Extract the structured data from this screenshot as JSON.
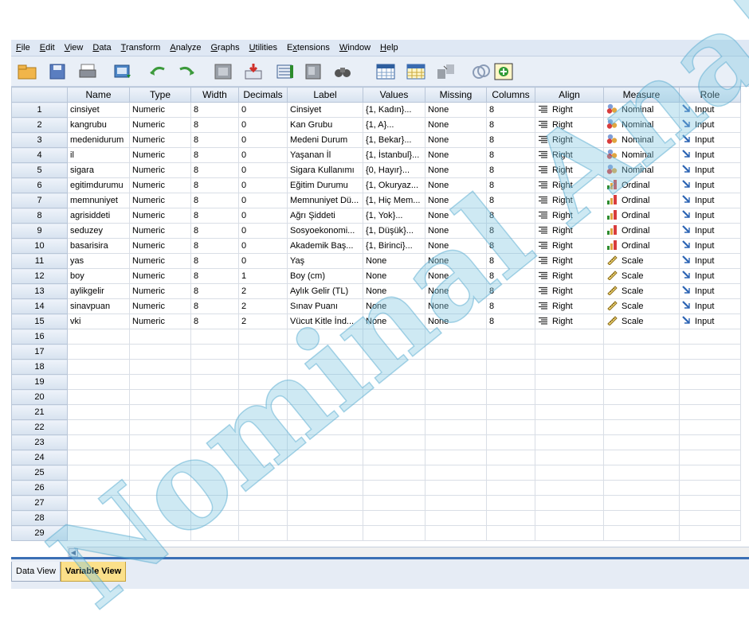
{
  "menu": [
    "File",
    "Edit",
    "View",
    "Data",
    "Transform",
    "Analyze",
    "Graphs",
    "Utilities",
    "Extensions",
    "Window",
    "Help"
  ],
  "menu_underline": [
    "F",
    "E",
    "V",
    "D",
    "T",
    "A",
    "G",
    "U",
    "x",
    "W",
    "H"
  ],
  "toolbar_icons": [
    "open-folder-icon",
    "save-icon",
    "print-icon",
    "dialog-recall-icon",
    "undo-icon",
    "redo-icon",
    "goto-case-icon",
    "goto-variable-icon",
    "variables-icon",
    "run-descriptives-icon",
    "find-icon",
    "split-file-icon",
    "select-cases-icon",
    "value-labels-icon",
    "use-sets-icon",
    "show-all-variables-icon"
  ],
  "columns": [
    "Name",
    "Type",
    "Width",
    "Decimals",
    "Label",
    "Values",
    "Missing",
    "Columns",
    "Align",
    "Measure",
    "Role"
  ],
  "rows": [
    {
      "n": "1",
      "name": "cinsiyet",
      "type": "Numeric",
      "width": "8",
      "dec": "0",
      "label": "Cinsiyet",
      "values": "{1, Kadın}...",
      "missing": "None",
      "columns": "8",
      "align": "Right",
      "measure": "Nominal",
      "role": "Input"
    },
    {
      "n": "2",
      "name": "kangrubu",
      "type": "Numeric",
      "width": "8",
      "dec": "0",
      "label": "Kan Grubu",
      "values": "{1, A}...",
      "missing": "None",
      "columns": "8",
      "align": "Right",
      "measure": "Nominal",
      "role": "Input"
    },
    {
      "n": "3",
      "name": "medenidurum",
      "type": "Numeric",
      "width": "8",
      "dec": "0",
      "label": "Medeni Durum",
      "values": "{1, Bekar}...",
      "missing": "None",
      "columns": "8",
      "align": "Right",
      "measure": "Nominal",
      "role": "Input"
    },
    {
      "n": "4",
      "name": "il",
      "type": "Numeric",
      "width": "8",
      "dec": "0",
      "label": "Yaşanan İl",
      "values": "{1, İstanbul}...",
      "missing": "None",
      "columns": "8",
      "align": "Right",
      "measure": "Nominal",
      "role": "Input"
    },
    {
      "n": "5",
      "name": "sigara",
      "type": "Numeric",
      "width": "8",
      "dec": "0",
      "label": "Sigara Kullanımı",
      "values": "{0, Hayır}...",
      "missing": "None",
      "columns": "8",
      "align": "Right",
      "measure": "Nominal",
      "role": "Input"
    },
    {
      "n": "6",
      "name": "egitimdurumu",
      "type": "Numeric",
      "width": "8",
      "dec": "0",
      "label": "Eğitim Durumu",
      "values": "{1, Okuryaz...",
      "missing": "None",
      "columns": "8",
      "align": "Right",
      "measure": "Ordinal",
      "role": "Input"
    },
    {
      "n": "7",
      "name": "memnuniyet",
      "type": "Numeric",
      "width": "8",
      "dec": "0",
      "label": "Memnuniyet Dü...",
      "values": "{1, Hiç Mem...",
      "missing": "None",
      "columns": "8",
      "align": "Right",
      "measure": "Ordinal",
      "role": "Input"
    },
    {
      "n": "8",
      "name": "agrisiddeti",
      "type": "Numeric",
      "width": "8",
      "dec": "0",
      "label": "Ağrı Şiddeti",
      "values": "{1, Yok}...",
      "missing": "None",
      "columns": "8",
      "align": "Right",
      "measure": "Ordinal",
      "role": "Input"
    },
    {
      "n": "9",
      "name": "seduzey",
      "type": "Numeric",
      "width": "8",
      "dec": "0",
      "label": "Sosyoekonomi...",
      "values": "{1, Düşük}...",
      "missing": "None",
      "columns": "8",
      "align": "Right",
      "measure": "Ordinal",
      "role": "Input"
    },
    {
      "n": "10",
      "name": "basarisira",
      "type": "Numeric",
      "width": "8",
      "dec": "0",
      "label": "Akademik Baş...",
      "values": "{1, Birinci}...",
      "missing": "None",
      "columns": "8",
      "align": "Right",
      "measure": "Ordinal",
      "role": "Input"
    },
    {
      "n": "11",
      "name": "yas",
      "type": "Numeric",
      "width": "8",
      "dec": "0",
      "label": "Yaş",
      "values": "None",
      "missing": "None",
      "columns": "8",
      "align": "Right",
      "measure": "Scale",
      "role": "Input"
    },
    {
      "n": "12",
      "name": "boy",
      "type": "Numeric",
      "width": "8",
      "dec": "1",
      "label": "Boy (cm)",
      "values": "None",
      "missing": "None",
      "columns": "8",
      "align": "Right",
      "measure": "Scale",
      "role": "Input"
    },
    {
      "n": "13",
      "name": "aylikgelir",
      "type": "Numeric",
      "width": "8",
      "dec": "2",
      "label": "Aylık Gelir (TL)",
      "values": "None",
      "missing": "None",
      "columns": "8",
      "align": "Right",
      "measure": "Scale",
      "role": "Input"
    },
    {
      "n": "14",
      "name": "sinavpuan",
      "type": "Numeric",
      "width": "8",
      "dec": "2",
      "label": "Sınav Puanı",
      "values": "None",
      "missing": "None",
      "columns": "8",
      "align": "Right",
      "measure": "Scale",
      "role": "Input"
    },
    {
      "n": "15",
      "name": "vki",
      "type": "Numeric",
      "width": "8",
      "dec": "2",
      "label": "Vücut Kitle İnd...",
      "values": "None",
      "missing": "None",
      "columns": "8",
      "align": "Right",
      "measure": "Scale",
      "role": "Input"
    }
  ],
  "empty_rows": [
    "16",
    "17",
    "18",
    "19",
    "20",
    "21",
    "22",
    "23",
    "24",
    "25",
    "26",
    "27",
    "28",
    "29"
  ],
  "tabs": {
    "data_view": "Data View",
    "variable_view": "Variable View"
  },
  "watermark": {
    "text": "Nominal Analiz",
    "color": "#7fc4df"
  },
  "colors": {
    "header_bg": "#dbe5f1",
    "active_tab": "#fbe08a",
    "menubar": "#dfe8f4"
  }
}
